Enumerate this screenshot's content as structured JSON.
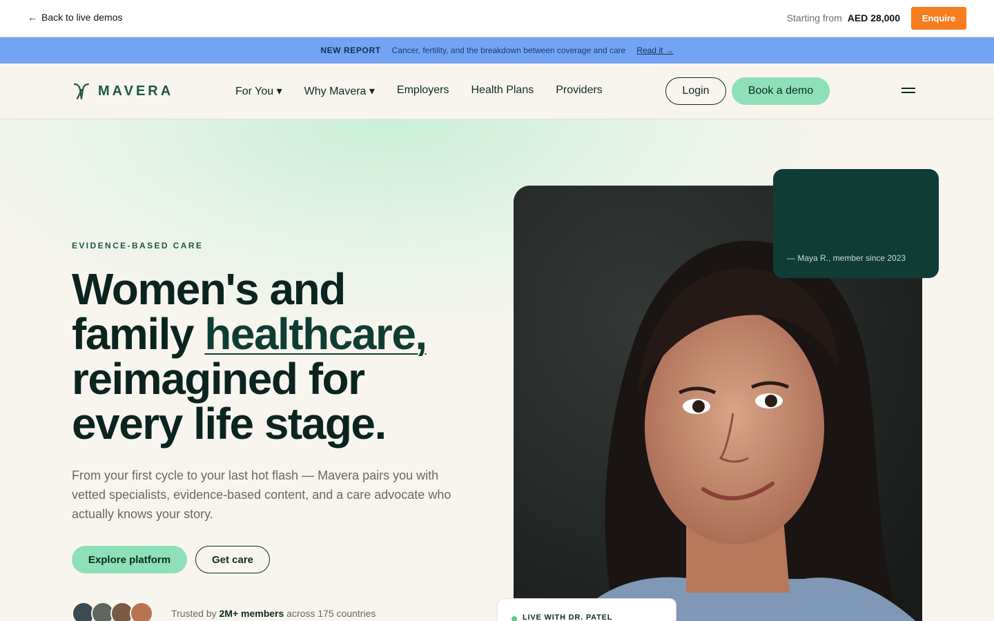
{
  "demo_bar": {
    "back_label": "Back to live demos",
    "back_icon": "arrow-left-icon",
    "price_prefix": "Starting from",
    "price_value": "AED 28,000",
    "enquire_label": "Enquire",
    "enquire_color": "#f57c1f"
  },
  "announcement": {
    "tag": "NEW REPORT",
    "text": "Cancer, fertility, and the breakdown between coverage and care",
    "link": "Read it →",
    "background": "#73a4f4"
  },
  "nav": {
    "logo_text": "MAVERA",
    "links": [
      "For You ▾",
      "Why Mavera ▾",
      "Employers",
      "Health Plans",
      "Providers"
    ],
    "login_label": "Login",
    "demo_label": "Book a demo",
    "menu_icon": "hamburger-menu-icon"
  },
  "hero": {
    "eyebrow": "EVIDENCE-BASED CARE",
    "headline_line1": "Women's and",
    "headline_line2_start": "family ",
    "headline_accent": "healthcare,",
    "headline_line3": "reimagined for",
    "headline_line4": "every life stage.",
    "subtitle": "From your first cycle to your last hot flash — Mavera pairs you with vetted specialists, evidence-based content, and a care advocate who actually knows your story.",
    "primary_cta": "Explore platform",
    "secondary_cta": "Get care",
    "trust_prefix": "Trusted by ",
    "trust_bold": "2M+ members",
    "trust_suffix": " across 175 countries",
    "quote_attribution": "— Maya R., member since 2023",
    "live_label": "LIVE WITH DR. PATEL"
  },
  "colors": {
    "accent_green": "#8de0b8",
    "dark_green": "#0f3d35",
    "background": "#f8f5ef"
  }
}
